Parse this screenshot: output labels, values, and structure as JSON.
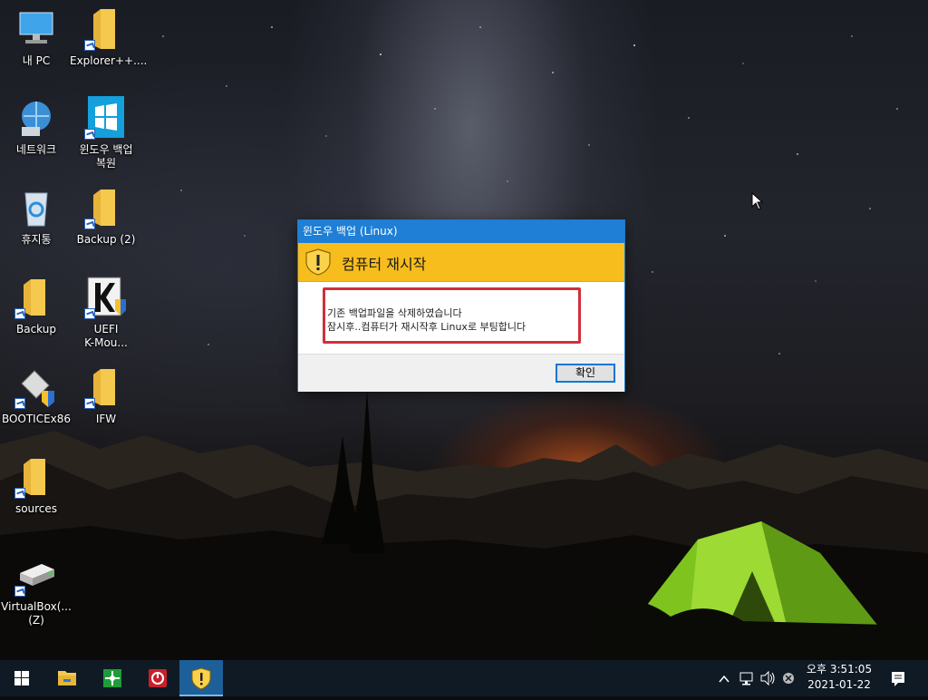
{
  "desktop": {
    "icons": [
      {
        "label": "내 PC"
      },
      {
        "label": "Explorer++...."
      },
      {
        "label": "네트워크"
      },
      {
        "label": "윈도우 백업\n복원"
      },
      {
        "label": "휴지통"
      },
      {
        "label": "Backup (2)"
      },
      {
        "label": "Backup"
      },
      {
        "label": "UEFI\nK-Mou..."
      },
      {
        "label": "BOOTICEx86"
      },
      {
        "label": "IFW"
      },
      {
        "label": "sources"
      },
      {
        "label": "VirtualBox(...\n(Z)"
      }
    ]
  },
  "dialog": {
    "title": "윈도우 백업 (Linux)",
    "heading": "컴퓨터 재시작",
    "message_line1": "기존 백업파일을 삭제하였습니다",
    "message_line2": "잠시후..컴퓨터가 재시작후 Linux로 부팅합니다",
    "ok_label": "확인",
    "header_color": "#f7bd1c",
    "highlight_color": "#d0303b"
  },
  "taskbar": {
    "buttons": [
      "start-icon",
      "file-explorer-icon",
      "green-app-icon",
      "red-power-app-icon",
      "shield-warning-app-icon"
    ],
    "tray": {
      "clock_time": "오후 3:51:05",
      "clock_date": "2021-01-22"
    }
  }
}
